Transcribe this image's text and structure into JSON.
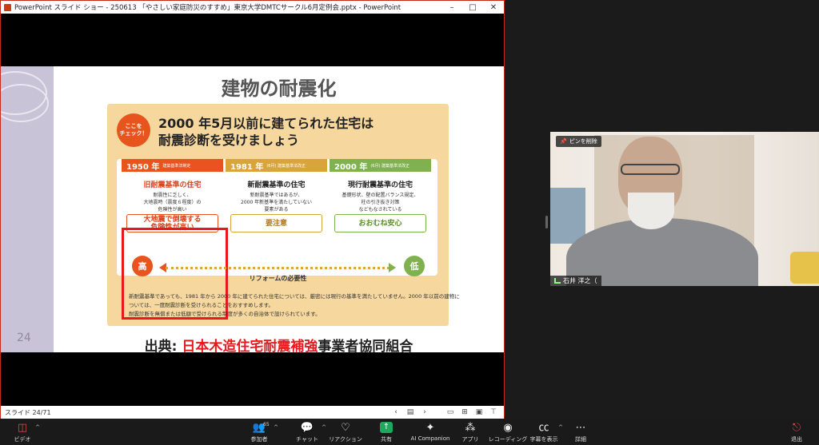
{
  "window": {
    "title": "PowerPoint スライド ショー  -  250613 「やさしい家庭防災のすすめ」東京大学DMTCサークル6月定例会.pptx - PowerPoint",
    "minimize": "–",
    "maximize": "□",
    "close": "✕"
  },
  "slide": {
    "number": "24",
    "title": "建物の耐震化",
    "badge": "ここを\nチェック！",
    "headline_1": "2000 年5月以前に建てられた住宅は",
    "headline_2": "耐震診断を受けましょう",
    "columns": [
      {
        "year": "1950 年",
        "sub": "建築基準法制定",
        "name": "旧耐震基準の住宅",
        "desc": "耐震性に乏しく、\n大地震時（震度６程度）の\n危険性が高い",
        "tag": "大地震で倒壊する\n危険性が高い",
        "color": "#e8541e"
      },
      {
        "year": "1981 年",
        "sub": "(6月)        建築基準法改正",
        "name": "新耐震基準の住宅",
        "desc": "新耐震基準ではあるが、\n2000 年新基準を満たしていない\n要素がある",
        "tag": "要注意",
        "color": "#d9a53a"
      },
      {
        "year": "2000 年",
        "sub": "(6月)      建築基準法改正",
        "name": "現行耐震基準の住宅",
        "desc": "基礎形状、壁の配置バランス規定、\n柱の引き抜き対策\nなどもなされている",
        "tag": "おおむね安心",
        "color": "#7fb24e"
      }
    ],
    "scale_high": "高",
    "scale_low": "低",
    "scale_label": "リフォームの必要性",
    "footnote": "新耐震基準であっても、1981 年から 2000 年に建てられた住宅については、厳密には現行の基準を満たしていません。2000 年以前の建物については、一度耐震診断を受けられることをおすすめします。\n耐震診断を無償または低額で受けられる制度が多くの自治体で設けられています。",
    "source_prefix": "出典",
    "source_colon": ":",
    "source_red": "日本木造住宅耐震補強",
    "source_rest": "事業者協同組合"
  },
  "status": {
    "slide_count": "スライド 24/71",
    "icons": [
      "chevron-left",
      "notes",
      "chevron-right",
      "normal-view",
      "slide-sorter",
      "reading-view",
      "slideshow-view"
    ]
  },
  "video": {
    "unpin_label": "ピンを削除",
    "participant_name": "石井 洋之（"
  },
  "toolbar": {
    "video": "ビデオ",
    "participants": "参加者",
    "participants_count": "65",
    "chat": "チャット",
    "reaction": "リアクション",
    "share": "共有",
    "ai": "AI Companion",
    "apps": "アプリ",
    "record": "レコーディング",
    "captions": "字幕を表示",
    "more": "詳細",
    "leave": "退出"
  }
}
